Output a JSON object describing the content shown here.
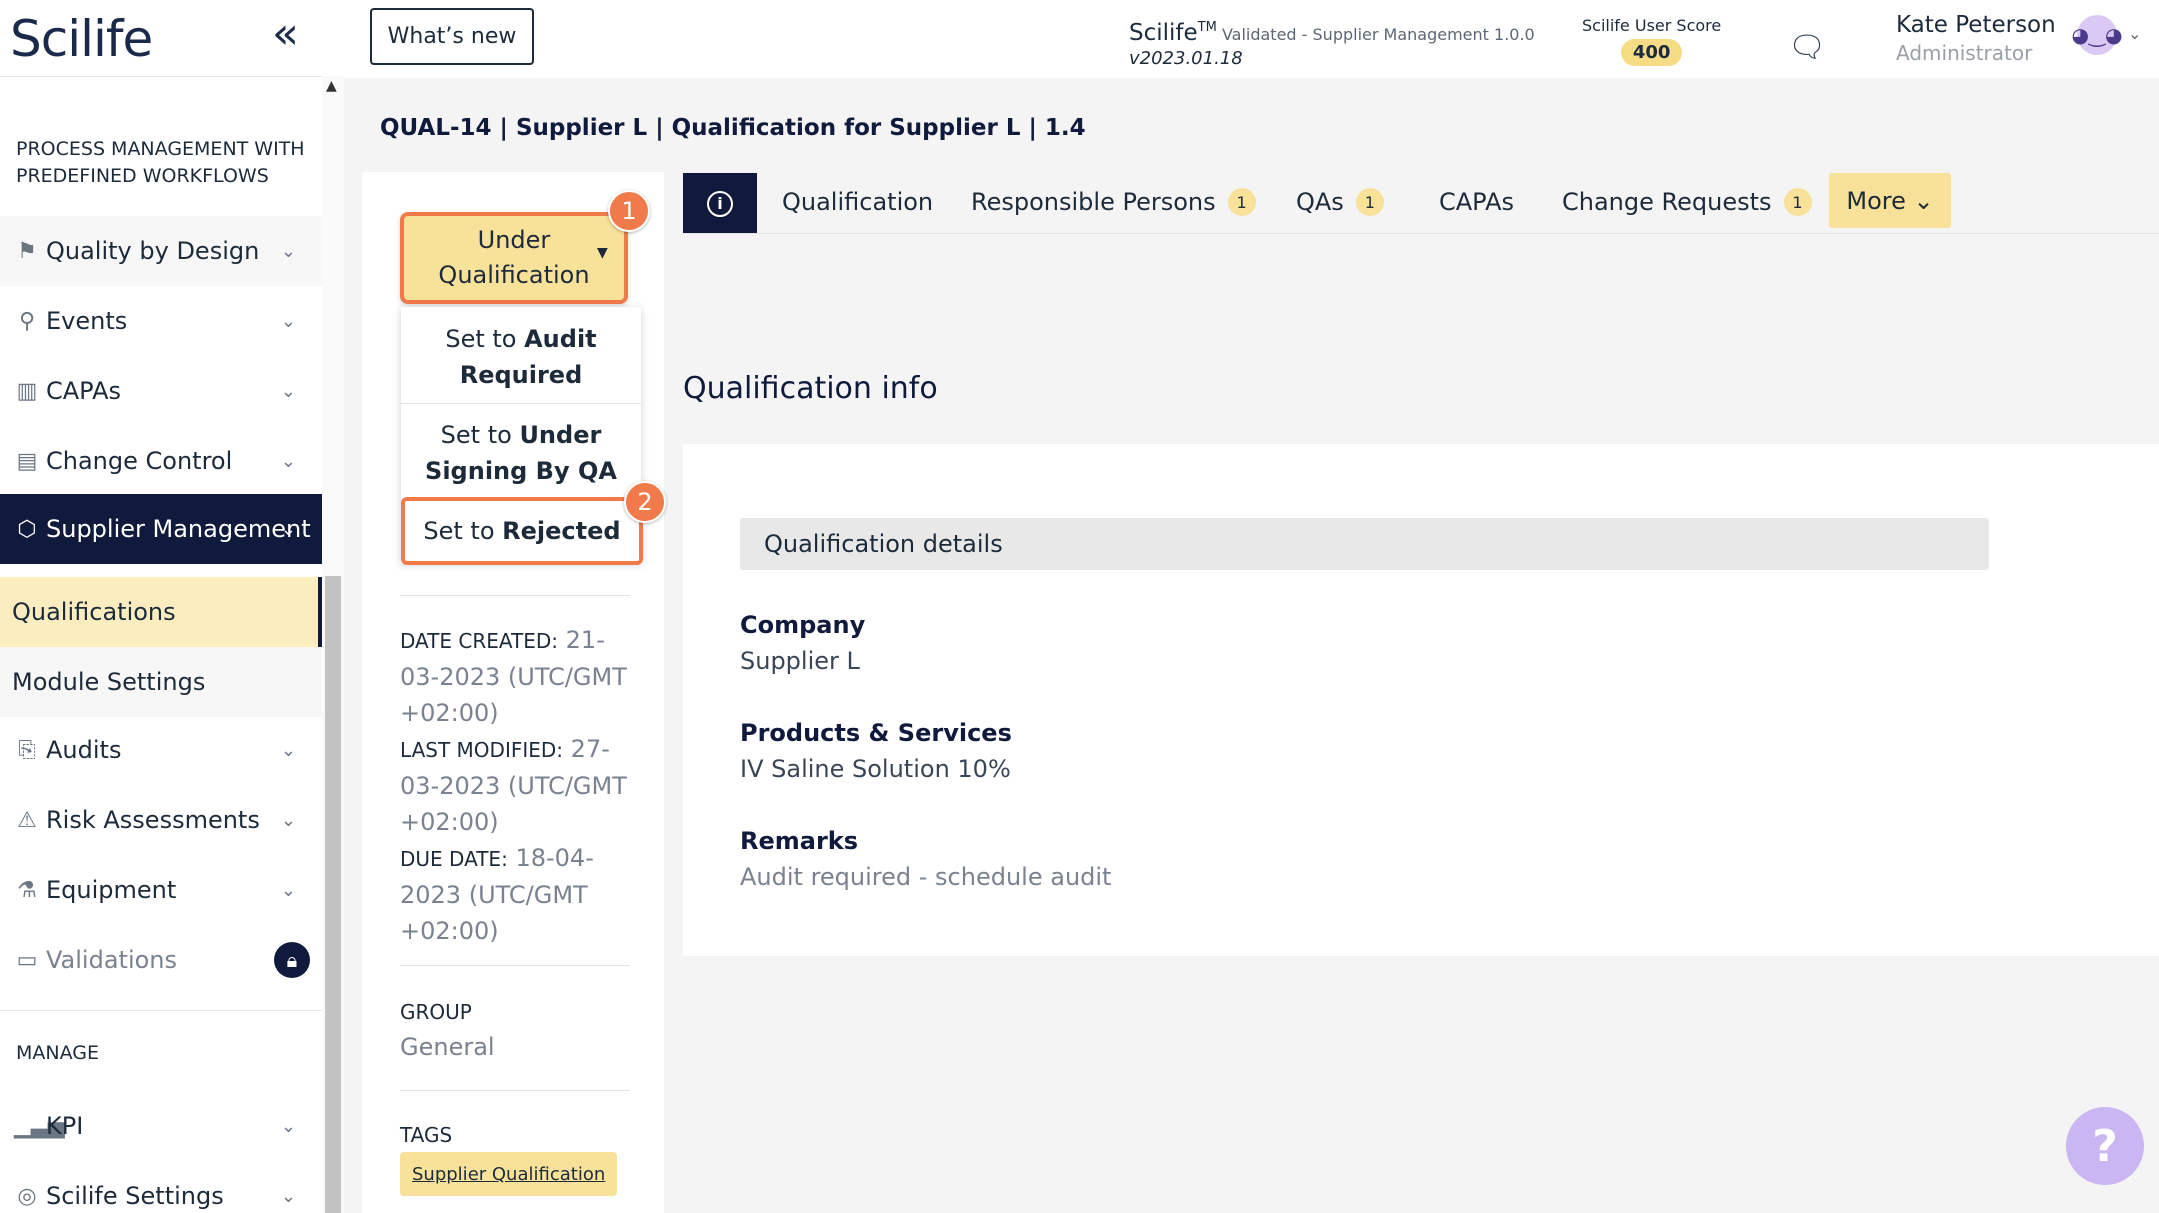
{
  "app": {
    "logo": "Scilife",
    "collapse_icon": "«"
  },
  "header": {
    "whats_new": "What’s new",
    "product_name": "Scilife",
    "product_tm": "TM",
    "product_validation": "Validated - Supplier Management 1.0.0",
    "product_version": "v2023.01.18",
    "score_label": "Scilife User Score",
    "score_value": "400",
    "user_name": "Kate Peterson",
    "user_role": "Administrator"
  },
  "sidebar": {
    "section_process": "PROCESS MANAGEMENT WITH PREDEFINED WORKFLOWS",
    "items": [
      {
        "label": "Quality by Design",
        "icon": "signpost-icon"
      },
      {
        "label": "Events",
        "icon": "pin-icon"
      },
      {
        "label": "CAPAs",
        "icon": "chart-icon"
      },
      {
        "label": "Change Control",
        "icon": "document-icon"
      },
      {
        "label": "Supplier Management",
        "icon": "box-icon"
      },
      {
        "label": "Audits",
        "icon": "audit-icon"
      },
      {
        "label": "Risk Assessments",
        "icon": "warning-icon"
      },
      {
        "label": "Equipment",
        "icon": "flask-icon"
      },
      {
        "label": "Validations",
        "icon": "clipboard-icon"
      }
    ],
    "sub_items": [
      "Qualifications",
      "Module Settings"
    ],
    "section_manage": "MANAGE",
    "manage_items": [
      {
        "label": "KPI",
        "icon": "bar-chart-icon"
      },
      {
        "label": "Scilife Settings",
        "icon": "settings-icon"
      }
    ]
  },
  "page": {
    "title": "QUAL-14 | Supplier L | Qualification for Supplier L | 1.4"
  },
  "status": {
    "current_line1": "Under",
    "current_line2": "Qualification",
    "options": [
      {
        "prefix": "Set to ",
        "bold_line1": "Audit",
        "bold_line2": "Required"
      },
      {
        "prefix": "Set to ",
        "bold_line1": "Under",
        "bold_line2": "Signing By QA"
      },
      {
        "prefix": "Set to ",
        "bold": "Rejected"
      }
    ],
    "callouts": [
      "1",
      "2"
    ]
  },
  "meta": {
    "date_created_label": "DATE CREATED:",
    "date_created_value": "21-03-2023 (UTC/GMT +02:00)",
    "last_modified_label": "LAST MODIFIED:",
    "last_modified_value": "27-03-2023 (UTC/GMT +02:00)",
    "due_date_label": "DUE DATE:",
    "due_date_value": "18-04-2023 (UTC/GMT +02:00)",
    "group_label": "GROUP",
    "group_value": "General",
    "tags_label": "TAGS",
    "tags": [
      "Supplier Qualification"
    ]
  },
  "tabs": [
    {
      "label": "Qualification",
      "count": ""
    },
    {
      "label": "Responsible Persons",
      "count": "1"
    },
    {
      "label": "QAs",
      "count": "1"
    },
    {
      "label": "CAPAs",
      "count": ""
    },
    {
      "label": "Change Requests",
      "count": "1"
    }
  ],
  "more_label": "More",
  "qualification": {
    "section_title": "Qualification info",
    "details_header": "Qualification details",
    "company_label": "Company",
    "company_value": "Supplier L",
    "products_label": "Products & Services",
    "products_value": "IV Saline Solution 10%",
    "remarks_label": "Remarks",
    "remarks_value": "Audit required - schedule audit"
  },
  "help": "?",
  "colors": {
    "navy": "#0f1a3c",
    "accent_yellow": "#f8e199",
    "callout_orange": "#f07a4a",
    "help_purple": "#c9b6f2"
  }
}
